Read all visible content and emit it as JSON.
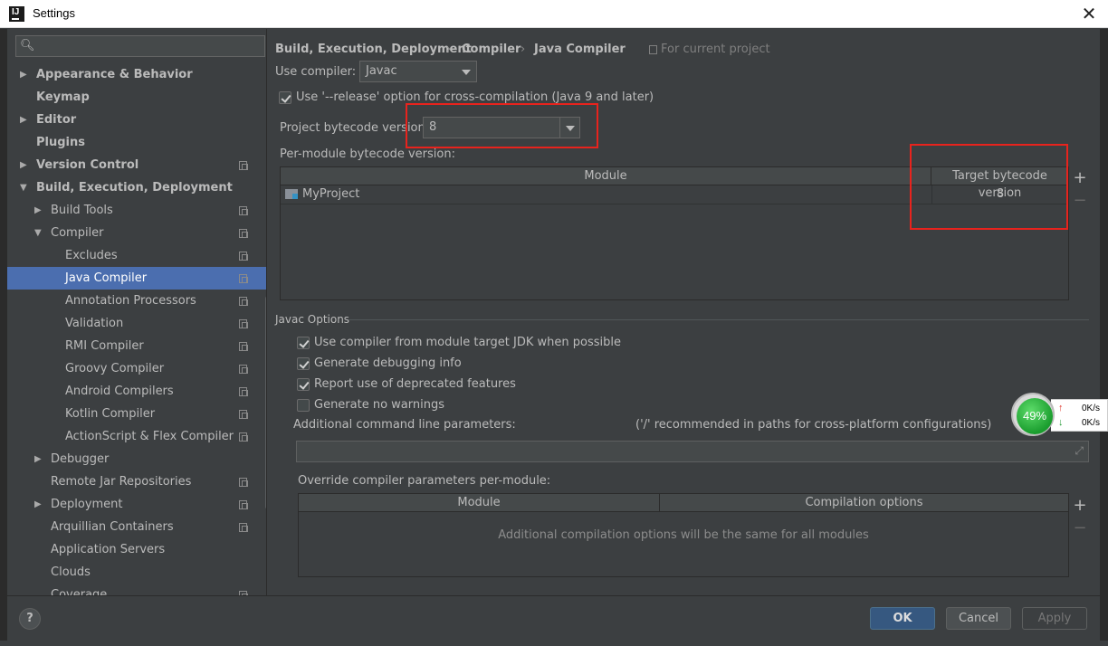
{
  "window": {
    "title": "Settings",
    "close_glyph": "✕"
  },
  "search": {
    "placeholder": "",
    "icon": "search-icon"
  },
  "sidebar": {
    "items": [
      {
        "label": "Appearance & Behavior",
        "level": 0,
        "bold": true,
        "arrow": "▶",
        "copy": false
      },
      {
        "label": "Keymap",
        "level": 0,
        "bold": true,
        "arrow": "",
        "copy": false
      },
      {
        "label": "Editor",
        "level": 0,
        "bold": true,
        "arrow": "▶",
        "copy": false
      },
      {
        "label": "Plugins",
        "level": 0,
        "bold": true,
        "arrow": "",
        "copy": false
      },
      {
        "label": "Version Control",
        "level": 0,
        "bold": true,
        "arrow": "▶",
        "copy": true
      },
      {
        "label": "Build, Execution, Deployment",
        "level": 0,
        "bold": true,
        "arrow": "▼",
        "copy": false
      },
      {
        "label": "Build Tools",
        "level": 1,
        "bold": false,
        "arrow": "▶",
        "copy": true
      },
      {
        "label": "Compiler",
        "level": 1,
        "bold": false,
        "arrow": "▼",
        "copy": true
      },
      {
        "label": "Excludes",
        "level": 2,
        "bold": false,
        "arrow": "",
        "copy": true
      },
      {
        "label": "Java Compiler",
        "level": 2,
        "bold": false,
        "arrow": "",
        "copy": true,
        "selected": true
      },
      {
        "label": "Annotation Processors",
        "level": 2,
        "bold": false,
        "arrow": "",
        "copy": true
      },
      {
        "label": "Validation",
        "level": 2,
        "bold": false,
        "arrow": "",
        "copy": true
      },
      {
        "label": "RMI Compiler",
        "level": 2,
        "bold": false,
        "arrow": "",
        "copy": true
      },
      {
        "label": "Groovy Compiler",
        "level": 2,
        "bold": false,
        "arrow": "",
        "copy": true
      },
      {
        "label": "Android Compilers",
        "level": 2,
        "bold": false,
        "arrow": "",
        "copy": true
      },
      {
        "label": "Kotlin Compiler",
        "level": 2,
        "bold": false,
        "arrow": "",
        "copy": true
      },
      {
        "label": "ActionScript & Flex Compiler",
        "level": 2,
        "bold": false,
        "arrow": "",
        "copy": true
      },
      {
        "label": "Debugger",
        "level": 1,
        "bold": false,
        "arrow": "▶",
        "copy": false
      },
      {
        "label": "Remote Jar Repositories",
        "level": 1,
        "bold": false,
        "arrow": "",
        "copy": true
      },
      {
        "label": "Deployment",
        "level": 1,
        "bold": false,
        "arrow": "▶",
        "copy": true
      },
      {
        "label": "Arquillian Containers",
        "level": 1,
        "bold": false,
        "arrow": "",
        "copy": true
      },
      {
        "label": "Application Servers",
        "level": 1,
        "bold": false,
        "arrow": "",
        "copy": false
      },
      {
        "label": "Clouds",
        "level": 1,
        "bold": false,
        "arrow": "",
        "copy": false
      },
      {
        "label": "Coverage",
        "level": 1,
        "bold": false,
        "arrow": "",
        "copy": true
      }
    ]
  },
  "breadcrumb": {
    "parts": [
      "Build, Execution, Deployment",
      "Compiler",
      "Java Compiler"
    ],
    "separator": "›",
    "scope": "For current project"
  },
  "main": {
    "use_compiler_label": "Use compiler:",
    "use_compiler_value": "Javac",
    "release_option_label": "Use '--release' option for cross-compilation (Java 9 and later)",
    "release_option_checked": true,
    "project_bytecode_label": "Project bytecode version:",
    "project_bytecode_value": "8",
    "per_module_label": "Per-module bytecode version:",
    "module_table": {
      "headers": [
        "Module",
        "Target bytecode version"
      ],
      "rows": [
        {
          "module": "MyProject",
          "target": "8"
        }
      ]
    },
    "add_glyph": "+",
    "remove_glyph": "−",
    "javac_section": "Javac Options",
    "options": [
      {
        "label": "Use compiler from module target JDK when possible",
        "checked": true
      },
      {
        "label": "Generate debugging info",
        "checked": true
      },
      {
        "label": "Report use of deprecated features",
        "checked": true
      },
      {
        "label": "Generate no warnings",
        "checked": false
      }
    ],
    "additional_params_label": "Additional command line parameters:",
    "additional_params_hint": "('/' recommended in paths for cross-platform configurations)",
    "additional_params_value": "",
    "override_label": "Override compiler parameters per-module:",
    "override_table": {
      "headers": [
        "Module",
        "Compilation options"
      ],
      "empty_text": "Additional compilation options will be the same for all modules"
    }
  },
  "buttons": {
    "help": "?",
    "ok": "OK",
    "cancel": "Cancel",
    "apply": "Apply"
  },
  "overlay": {
    "percent": "49%",
    "up_rate": "0K/s",
    "down_rate": "0K/s",
    "up_arrow": "↑",
    "down_arrow": "↓"
  },
  "colors": {
    "accent": "#4b6eaf",
    "highlight": "#e8231d",
    "background": "#3c3f41"
  }
}
